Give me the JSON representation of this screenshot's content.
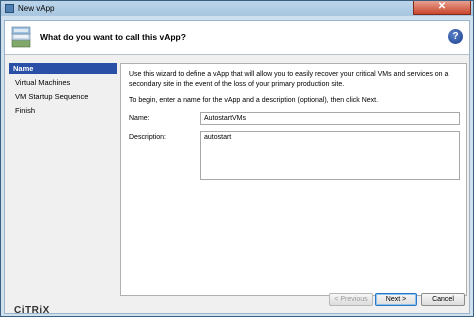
{
  "window": {
    "title": "New vApp",
    "close_glyph": "✕"
  },
  "header": {
    "title": "What do you want to call this vApp?",
    "help_glyph": "?"
  },
  "sidebar": {
    "items": [
      {
        "label": "Name",
        "active": true
      },
      {
        "label": "Virtual Machines",
        "active": false
      },
      {
        "label": "VM Startup Sequence",
        "active": false
      },
      {
        "label": "Finish",
        "active": false
      }
    ],
    "brand": "CiTRiX"
  },
  "content": {
    "intro": "Use this wizard to define a vApp that will allow you to easily recover your critical VMs and services on a secondary site in the event of the loss of your primary production site.",
    "instruction": "To begin, enter a name for the vApp and a description (optional), then click Next.",
    "name_label": "Name:",
    "name_value": "AutostartVMs",
    "description_label": "Description:",
    "description_value": "autostart"
  },
  "buttons": {
    "previous": "< Previous",
    "next": "Next >",
    "cancel": "Cancel"
  }
}
